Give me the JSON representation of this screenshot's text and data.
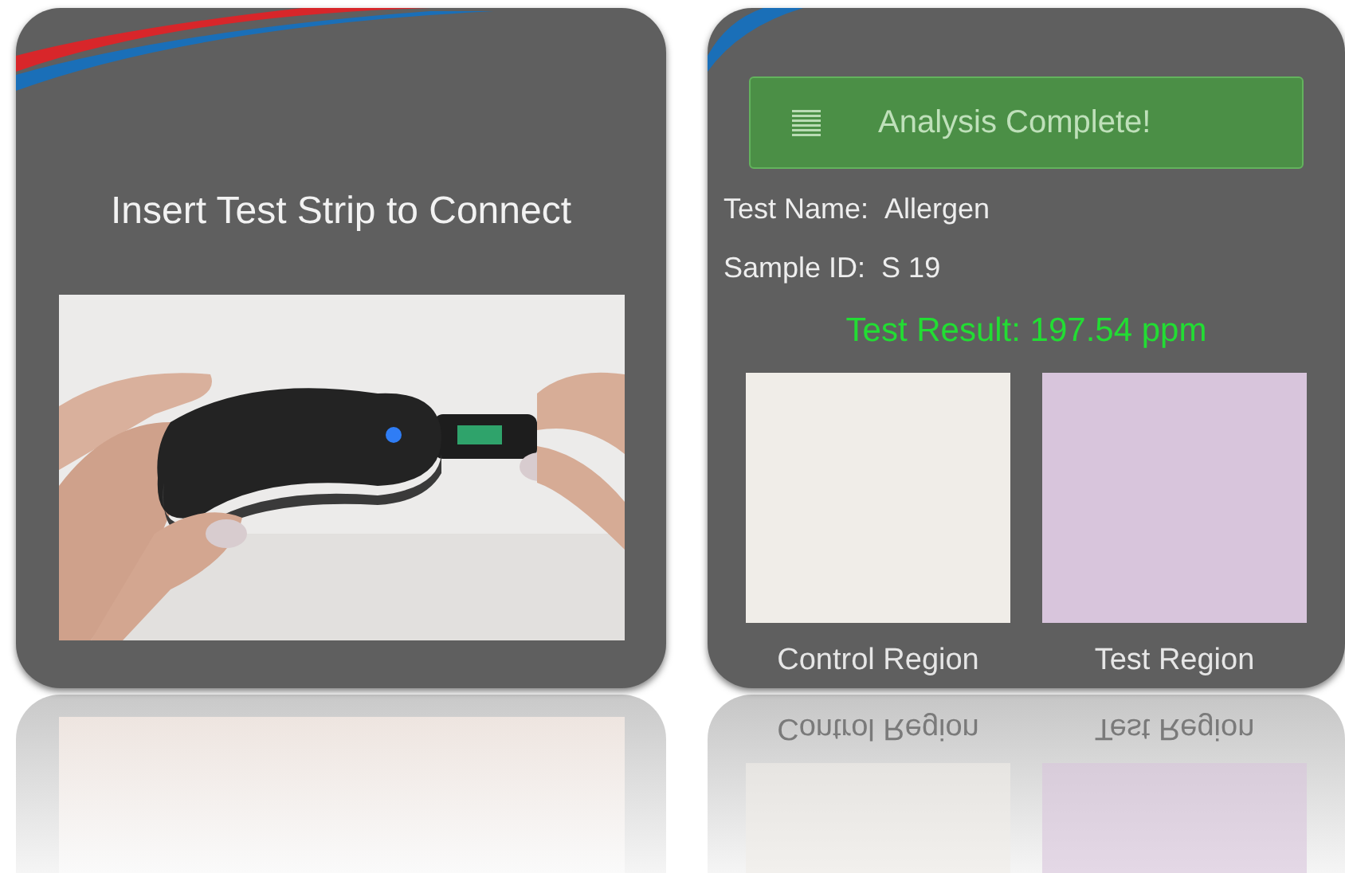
{
  "connect_screen": {
    "title": "Insert Test Strip to Connect"
  },
  "result_screen": {
    "banner": "Analysis Complete!",
    "fields": [
      {
        "label": "Test Name:",
        "value": "Allergen"
      },
      {
        "label": "Sample ID:",
        "value": "S 19"
      }
    ],
    "result": "Test Result: 197.54 ppm",
    "regions": [
      {
        "label": "Control Region",
        "color": "#f0ede8"
      },
      {
        "label": "Test Region",
        "color": "#d8c5dc"
      }
    ]
  },
  "reflection": {
    "labels": [
      "Control Region",
      "Test Region"
    ]
  }
}
